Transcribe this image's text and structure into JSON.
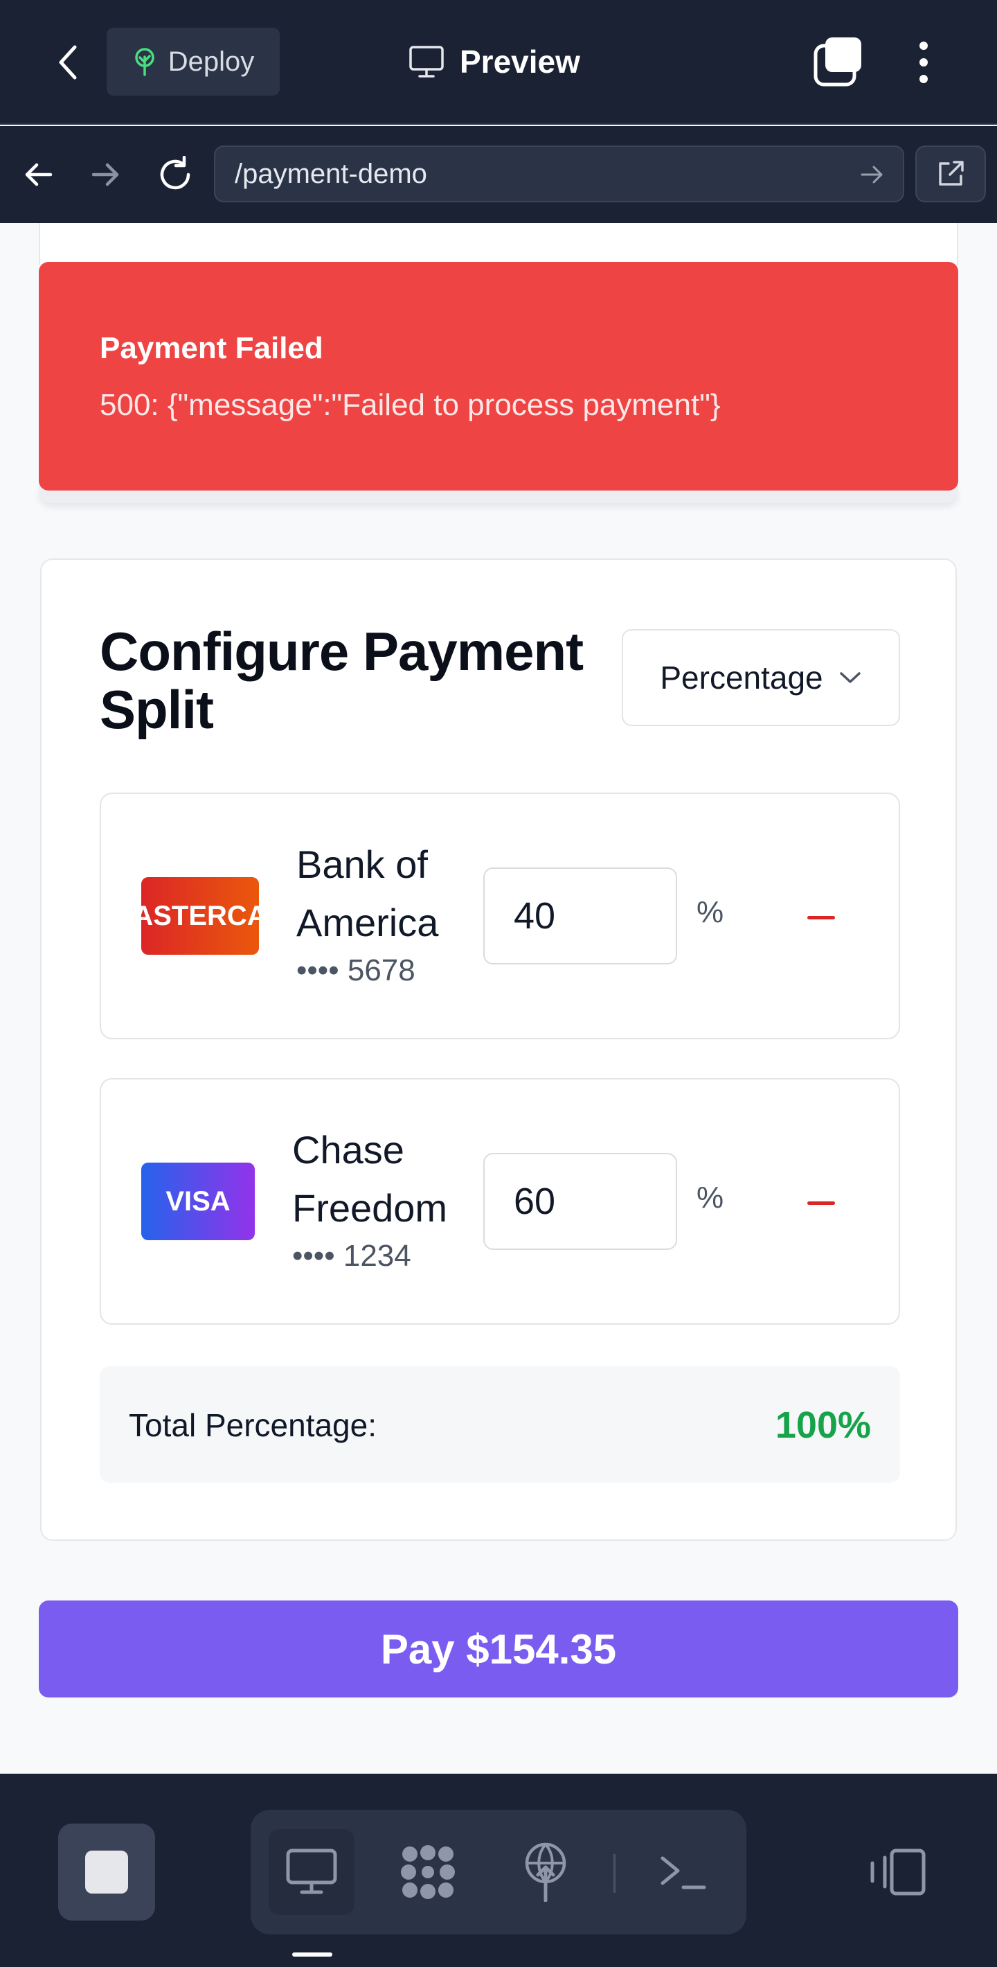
{
  "topbar": {
    "deploy_label": "Deploy",
    "title": "Preview",
    "icons": [
      "back-arrow-icon",
      "tree-icon",
      "monitor-icon",
      "tabs-icon",
      "more-vertical-icon"
    ]
  },
  "urlbar": {
    "url": "/payment-demo",
    "icons": [
      "back-icon",
      "forward-icon",
      "reload-icon",
      "go-arrow-icon",
      "external-link-icon"
    ]
  },
  "error": {
    "title": "Payment Failed",
    "message": "500: {\"message\":\"Failed to process payment\"}"
  },
  "split": {
    "title": "Configure Payment Split",
    "mode": "Percentage",
    "methods": [
      {
        "brand": "ASTERCA",
        "name": "Bank of America",
        "last4": "•••• 5678",
        "value": "40",
        "unit": "%"
      },
      {
        "brand": "VISA",
        "name": "Chase Freedom",
        "last4": "•••• 1234",
        "value": "60",
        "unit": "%"
      }
    ],
    "total_label": "Total Percentage:",
    "total_value": "100%"
  },
  "pay_label": "Pay $154.35",
  "colors": {
    "chrome": "#1b2234",
    "error": "#ef4444",
    "pay": "#7b5cf0",
    "success": "#16a34a",
    "remove": "#dc2626"
  },
  "bottombar": {
    "tools": [
      "stop-icon",
      "desktop-icon",
      "apps-icon",
      "publish-icon",
      "terminal-icon",
      "device-rotate-icon"
    ]
  }
}
